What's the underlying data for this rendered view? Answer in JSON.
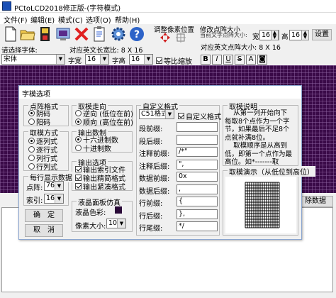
{
  "window": {
    "title": "PCtoLCD2018修正版-(字符模式)"
  },
  "menu": [
    "文件(F)",
    "编辑(E)",
    "模式(C)",
    "选项(O)",
    "帮助(H)"
  ],
  "toolbar": {
    "icons": [
      "new-file-icon",
      "open-folder-icon",
      "save-icon",
      "export-icon",
      "delete-icon",
      "clipboard-icon",
      "gear-icon",
      "help-icon"
    ],
    "adjust_pos_label": "调整像素位置",
    "resize_label": "修改点阵大小",
    "current_size_hint": "当前文字点阵大小:",
    "width_label": "宽",
    "width_value": "16",
    "height_label": "高",
    "height_value": "16",
    "set_button": "设置"
  },
  "fontrow": {
    "choose_font_label": "请选择字体:",
    "english_size_text": "对应英文长宽比: 8 X 16",
    "chinese_size_text": "对应英文点阵大小: 8 X 16",
    "font_value": "宋体",
    "char_width_label": "字宽",
    "char_width_value": "16",
    "char_height_label": "字高",
    "char_height_value": "16",
    "scale_label": "等比缩放",
    "scale_checked": true,
    "format_buttons": [
      "B",
      "I",
      "U",
      "S",
      "A",
      "◙"
    ]
  },
  "colors": {
    "grid": "#3a0a48",
    "lcd_swatch": "#2a0a38"
  },
  "dialog": {
    "title": "字模选项",
    "dot_format": {
      "label": "点阵格式",
      "options": [
        "阴码",
        "阳码"
      ],
      "selected": 0
    },
    "scan_direction": {
      "label": "取模走向",
      "options": [
        "逆向 (低位在前)",
        "顺向 (高位在前)"
      ],
      "selected": 1
    },
    "mode": {
      "label": "取模方式",
      "options": [
        "逐列式",
        "逐行式",
        "列行式",
        "行列式"
      ],
      "selected": 0
    },
    "output_base": {
      "label": "输出数制",
      "options": [
        "十六进制数",
        "十进制数"
      ],
      "selected": 0
    },
    "output_options": {
      "label": "输出选项",
      "options": [
        "输出索引文件",
        "输出精简格式",
        "输出紧凑格式"
      ],
      "checked": [
        true,
        true,
        true
      ]
    },
    "per_line": {
      "label": "每行显示数据",
      "dots_label": "点阵:",
      "dots_value": "76",
      "index_label": "索引:",
      "index_value": "16"
    },
    "lcd_sim": {
      "label": "液晶面板仿真",
      "color_label": "液晶色彩:",
      "pixel_label": "像素大小:",
      "pixel_value": "10"
    },
    "custom_format": {
      "label": "自定义格式",
      "format_value": "C51格式",
      "custom_checkbox": "自定义格式",
      "custom_checked": true,
      "fields": [
        {
          "label": "段前缀:",
          "value": ""
        },
        {
          "label": "段后缀:",
          "value": ""
        },
        {
          "label": "注释前缀:",
          "value": "/*\""
        },
        {
          "label": "注释后缀:",
          "value": "\","
        },
        {
          "label": "数据前缀:",
          "value": "0x"
        },
        {
          "label": "数据后缀:",
          "value": ","
        },
        {
          "label": "行前缀:",
          "value": "{"
        },
        {
          "label": "行后缀:",
          "value": "},"
        },
        {
          "label": "行尾缀:",
          "value": "*/"
        }
      ]
    },
    "explanation": {
      "label": "取模说明",
      "text": "    从第一列开始向下\n每取8个点作为一个字\n节，如果最后不足8个\n点就补满8位。\n    取模顺序是从高到\n低，即第一个点作为最\n高位。如*-------取\n为10000000"
    },
    "demo": {
      "label": "取模演示（从低位到高位）"
    },
    "ok_button": "确　定",
    "cancel_button": "取　消"
  },
  "main": {
    "right_button": "除数据"
  }
}
